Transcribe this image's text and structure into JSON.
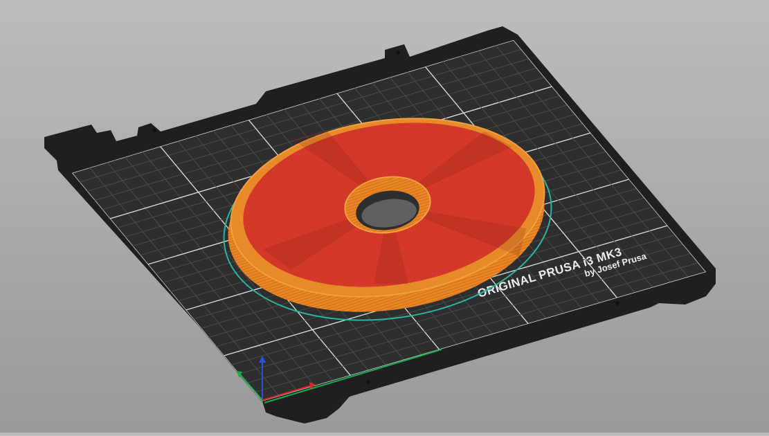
{
  "bed": {
    "brand_text": "ORIGINAL PRUSA i3  MK3",
    "byline_text": "by Josef Prusa"
  },
  "colors": {
    "background": "#a9a9a9",
    "bed_surface": "#2e2e2e",
    "bed_edge": "#1f1f1f",
    "grid_line": "#d8d8d8",
    "infill": "#d63a2a",
    "perimeter": "#e07a1c",
    "skirt": "#2bb3a0",
    "axis_x": "#d42a2a",
    "axis_y": "#1ea84a",
    "axis_z": "#2850e0"
  },
  "icons": [
    "axis-gizmo-icon"
  ]
}
